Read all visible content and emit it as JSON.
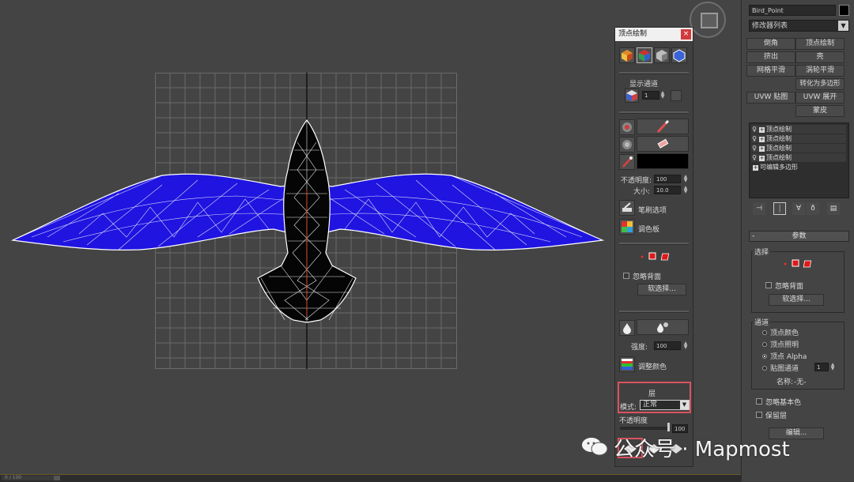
{
  "viewport": {
    "status_field": "0 / 100"
  },
  "paint_panel": {
    "title": "顶点绘制",
    "close": "×",
    "display_channel_label": "显示通道",
    "channel_value": "1",
    "opacity_label": "不透明度:",
    "opacity_value": "100",
    "size_label": "大小:",
    "size_value": "10.0",
    "brush_options_label": "笔刷选项",
    "palette_label": "调色板",
    "ignore_backface_label": "忽略背面",
    "soft_select_label": "软选择...",
    "strength_label": "强度:",
    "strength_value": "100",
    "adjust_color_label": "调整颜色",
    "layer_label": "层",
    "mode_label": "模式:",
    "mode_value": "正常",
    "layer_opacity_label": "不透明度",
    "layer_opacity_value": "100"
  },
  "command_panel": {
    "object_name": "Bird_Point",
    "modifier_list": "修改器列表",
    "buttons": [
      "倒角",
      "顶点绘制",
      "挤出",
      "壳",
      "网格平滑",
      "涡轮平滑",
      "转化为多边形",
      "UVW 贴图",
      "UVW 展开",
      "蒙皮"
    ],
    "stack": [
      "顶点绘制",
      "顶点绘制",
      "顶点绘制",
      "顶点绘制",
      "可编辑多边形"
    ],
    "params_title": "参数",
    "selection_label": "选择",
    "ignore_backface_label": "忽略背面",
    "soft_select_label": "软选择...",
    "channel_group_label": "通道",
    "channel_options": [
      "顶点颜色",
      "顶点照明",
      "顶点 Alpha",
      "贴图通道"
    ],
    "map_channel_value": "1",
    "name_label": "名称:",
    "name_value": "-无-",
    "ignore_base_color_label": "忽略基本色",
    "keep_layer_label": "保留层",
    "edit_button": "编辑..."
  },
  "watermark": {
    "text": "公众号 · Mapmost"
  },
  "colors": {
    "wing_fill": "#1f14e0",
    "body_fill": "#050505",
    "wire": "#ffffff",
    "highlight_border": "#d9535f"
  }
}
